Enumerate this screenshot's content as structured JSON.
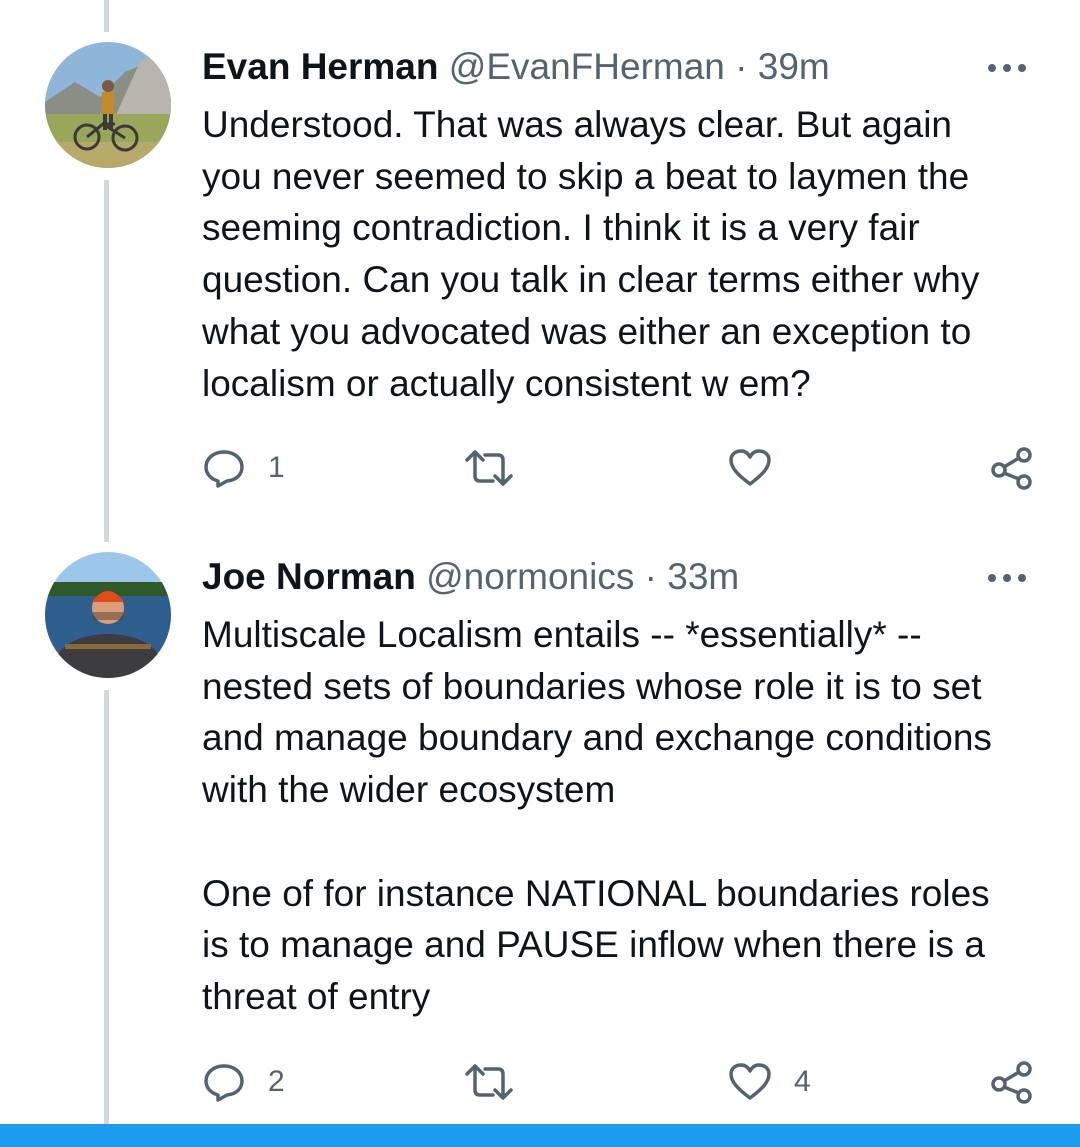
{
  "tweets": [
    {
      "name": "Evan Herman",
      "handle": "@EvanFHerman",
      "separator": "·",
      "time": "39m",
      "text": "Understood. That was always clear. But again\nyou never seemed to skip a beat to laymen the\nseeming contradiction.  I think it is a very fair\nquestion.  Can you talk in clear terms either why\nwhat you advocated was either an exception to\nlocalism or actually consistent w em?",
      "replies": "1",
      "retweets": "",
      "likes": ""
    },
    {
      "name": "Joe Norman",
      "handle": "@normonics",
      "separator": "·",
      "time": "33m",
      "text": "Multiscale Localism entails -- *essentially* --\nnested sets of boundaries whose role it is to set\nand manage boundary and exchange conditions\nwith the wider ecosystem\n\nOne of for instance NATIONAL boundaries roles\nis to manage and PAUSE inflow when there is a\nthreat of entry",
      "replies": "2",
      "retweets": "",
      "likes": "4"
    }
  ],
  "icons": {
    "reply": "reply-icon",
    "retweet": "retweet-icon",
    "like": "heart-icon",
    "share": "share-icon",
    "more": "more-icon"
  },
  "colors": {
    "text": "#0f1419",
    "secondary": "#536471",
    "thread_line": "#cfd9de",
    "bottom_bar": "#1d9bf0"
  }
}
